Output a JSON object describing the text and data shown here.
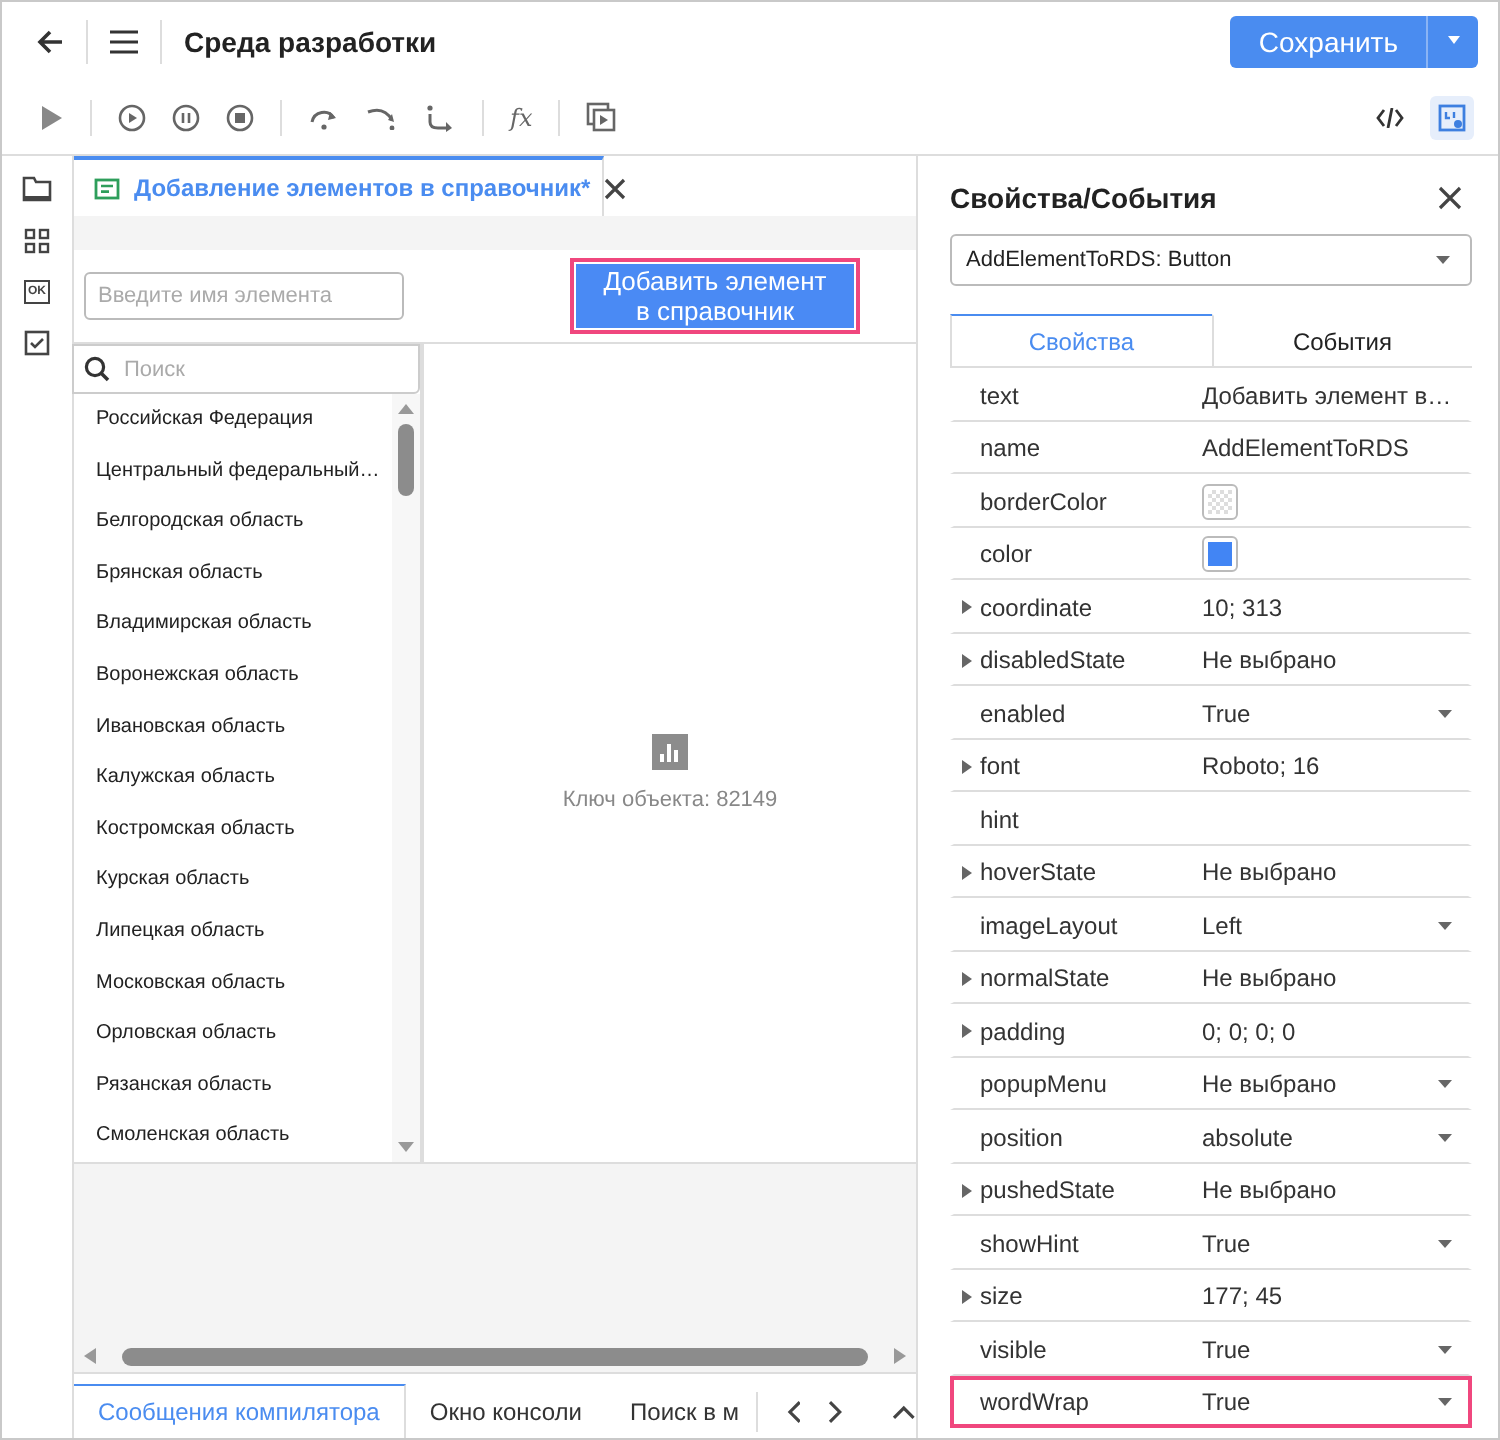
{
  "header": {
    "title": "Среда разработки",
    "save_button": "Сохранить"
  },
  "toolbar": {
    "formula_button": "fx"
  },
  "left_toolbar": {
    "button_icon_label": "OK"
  },
  "editor_tab": {
    "title": "Добавление элементов в справочник*",
    "selected": true
  },
  "form": {
    "name_input": {
      "placeholder": "Введите имя элемента"
    },
    "add_button": {
      "label": "Добавить элемент в справочник",
      "selected": true
    }
  },
  "list": {
    "search": {
      "placeholder": "Поиск"
    },
    "items": [
      "Российская Федерация",
      "Центральный федеральный…",
      "Белгородская область",
      "Брянская область",
      "Владимирская область",
      "Воронежская область",
      "Ивановская область",
      "Калужская область",
      "Костромская область",
      "Курская область",
      "Липецкая область",
      "Московская область",
      "Орловская область",
      "Рязанская область",
      "Смоленская область"
    ]
  },
  "preview": {
    "caption": "Ключ объекта: 82149"
  },
  "bottom_tabs": [
    {
      "label": "Сообщения компилятора",
      "selected": true
    },
    {
      "label": "Окно консоли",
      "selected": false
    },
    {
      "label": "Поиск в м",
      "selected": false
    }
  ],
  "properties_panel": {
    "title": "Свойства/События",
    "object_select": "AddElementToRDS: Button",
    "tabs": [
      {
        "label": "Свойства",
        "selected": true
      },
      {
        "label": "События",
        "selected": false
      }
    ],
    "rows": [
      {
        "name": "text",
        "kind": "text",
        "value": "Добавить элемент в…",
        "expandable": false,
        "dropdown": false,
        "selected": false
      },
      {
        "name": "name",
        "kind": "text",
        "value": "AddElementToRDS",
        "expandable": false,
        "dropdown": false,
        "selected": false
      },
      {
        "name": "borderColor",
        "kind": "empty_swatch",
        "expandable": false,
        "dropdown": false,
        "selected": false
      },
      {
        "name": "color",
        "kind": "swatch",
        "color": "#4285f4",
        "expandable": false,
        "dropdown": false,
        "selected": false
      },
      {
        "name": "coordinate",
        "kind": "text",
        "value": "10; 313",
        "expandable": true,
        "dropdown": false,
        "selected": false
      },
      {
        "name": "disabledState",
        "kind": "text",
        "value": "Не выбрано",
        "expandable": true,
        "dropdown": false,
        "selected": false
      },
      {
        "name": "enabled",
        "kind": "text",
        "value": "True",
        "expandable": false,
        "dropdown": true,
        "selected": false
      },
      {
        "name": "font",
        "kind": "text",
        "value": "Roboto; 16",
        "expandable": true,
        "dropdown": false,
        "selected": false
      },
      {
        "name": "hint",
        "kind": "text",
        "expandable": false,
        "dropdown": false,
        "selected": false
      },
      {
        "name": "hoverState",
        "kind": "text",
        "value": "Не выбрано",
        "expandable": true,
        "dropdown": false,
        "selected": false
      },
      {
        "name": "imageLayout",
        "kind": "text",
        "value": "Left",
        "expandable": false,
        "dropdown": true,
        "selected": false
      },
      {
        "name": "normalState",
        "kind": "text",
        "value": "Не выбрано",
        "expandable": true,
        "dropdown": false,
        "selected": false
      },
      {
        "name": "padding",
        "kind": "text",
        "value": "0; 0; 0; 0",
        "expandable": true,
        "dropdown": false,
        "selected": false
      },
      {
        "name": "popupMenu",
        "kind": "text",
        "value": "Не выбрано",
        "expandable": false,
        "dropdown": true,
        "selected": false
      },
      {
        "name": "position",
        "kind": "text",
        "value": "absolute",
        "expandable": false,
        "dropdown": true,
        "selected": false
      },
      {
        "name": "pushedState",
        "kind": "text",
        "value": "Не выбрано",
        "expandable": true,
        "dropdown": false,
        "selected": false
      },
      {
        "name": "showHint",
        "kind": "text",
        "value": "True",
        "expandable": false,
        "dropdown": true,
        "selected": false
      },
      {
        "name": "size",
        "kind": "text",
        "value": "177; 45",
        "expandable": true,
        "dropdown": false,
        "selected": false
      },
      {
        "name": "visible",
        "kind": "text",
        "value": "True",
        "expandable": false,
        "dropdown": true,
        "selected": false
      },
      {
        "name": "wordWrap",
        "kind": "text",
        "value": "True",
        "expandable": false,
        "dropdown": true,
        "selected": true
      }
    ]
  }
}
